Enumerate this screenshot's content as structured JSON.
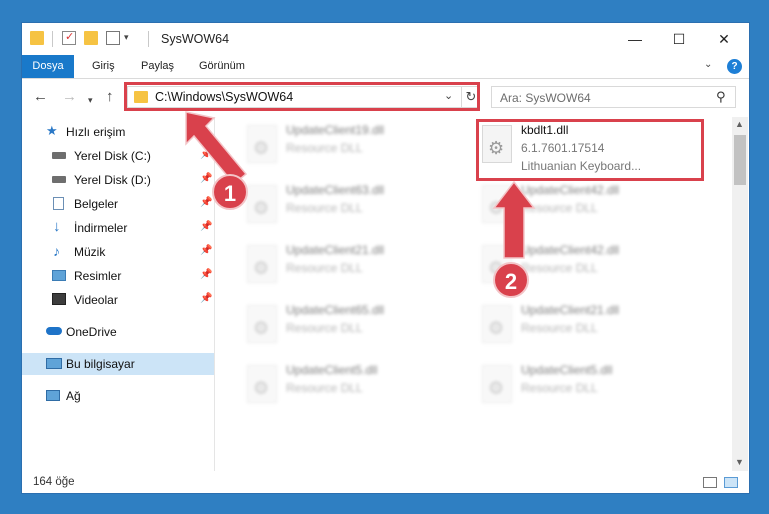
{
  "window": {
    "title": "SysWOW64",
    "buttons": {
      "minimize": "—",
      "maximize": "☐",
      "close": "✕"
    }
  },
  "ribbon": {
    "tabs": [
      "Dosya",
      "Giriş",
      "Paylaş",
      "Görünüm"
    ],
    "help": "?"
  },
  "address": {
    "path": "C:\\Windows\\SysWOW64",
    "search_placeholder": "Ara: SysWOW64"
  },
  "sidebar": {
    "items": [
      {
        "label": "Hızlı erişim",
        "icon": "star-icon",
        "pinned": false
      },
      {
        "label": "Yerel Disk (C:)",
        "icon": "drive-icon",
        "pinned": true
      },
      {
        "label": "Yerel Disk (D:)",
        "icon": "drive-icon",
        "pinned": true
      },
      {
        "label": "Belgeler",
        "icon": "document-icon",
        "pinned": true
      },
      {
        "label": "İndirmeler",
        "icon": "download-icon",
        "pinned": true
      },
      {
        "label": "Müzik",
        "icon": "music-icon",
        "pinned": true
      },
      {
        "label": "Resimler",
        "icon": "pictures-icon",
        "pinned": true
      },
      {
        "label": "Videolar",
        "icon": "video-icon",
        "pinned": true
      },
      {
        "label": "OneDrive",
        "icon": "cloud-icon",
        "pinned": false
      },
      {
        "label": "Bu bilgisayar",
        "icon": "computer-icon",
        "pinned": false
      },
      {
        "label": "Ağ",
        "icon": "network-icon",
        "pinned": false
      }
    ]
  },
  "files": {
    "left": [
      {
        "name": "UpdateClient19.dll",
        "desc": "Resource DLL"
      },
      {
        "name": "UpdateClient63.dll",
        "desc": "Resource DLL"
      },
      {
        "name": "UpdateClient21.dll",
        "desc": "Resource DLL"
      },
      {
        "name": "UpdateClient65.dll",
        "desc": "Resource DLL"
      },
      {
        "name": "UpdateClient5.dll",
        "desc": "Resource DLL"
      }
    ],
    "right": [
      {
        "name": "kbdlt1.dll",
        "desc": "6.1.7601.17514",
        "desc2": "Lithuanian Keyboard..."
      },
      {
        "name": "UpdateClient42.dll",
        "desc": "Resource DLL"
      },
      {
        "name": "UpdateClient42.dll",
        "desc": "Resource DLL"
      },
      {
        "name": "UpdateClient21.dll",
        "desc": "Resource DLL"
      },
      {
        "name": "UpdateClient5.dll",
        "desc": "Resource DLL"
      }
    ]
  },
  "status": {
    "count": "164 öğe"
  },
  "annotations": {
    "step1": "1",
    "step2": "2",
    "highlight_color": "#d9414c"
  }
}
